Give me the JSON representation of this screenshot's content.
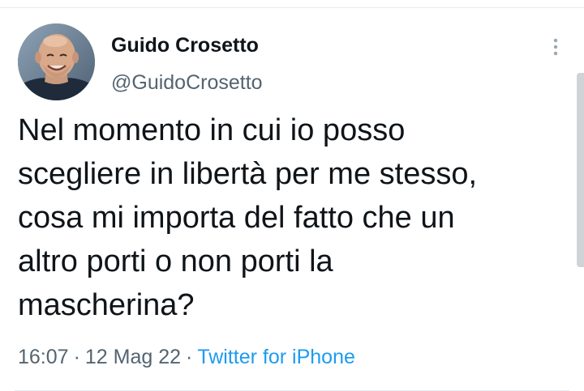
{
  "tweet": {
    "author": {
      "display_name": "Guido Crosetto",
      "handle": "@GuidoCrosetto",
      "avatar_icon": "profile-photo"
    },
    "text_lines": [
      "Nel momento in cui io posso",
      "scegliere in libertà per me stesso,",
      "cosa mi importa del fatto che un",
      "altro porti o non porti la",
      "mascherina?"
    ],
    "time": "16:07",
    "date": "12 Mag 22",
    "separator": "·",
    "source": "Twitter for iPhone",
    "more_icon": "more-vertical-icon"
  },
  "colors": {
    "text_primary": "#0f1419",
    "text_secondary": "#536471",
    "link": "#1d9bf0",
    "divider": "#e6ecf0"
  }
}
